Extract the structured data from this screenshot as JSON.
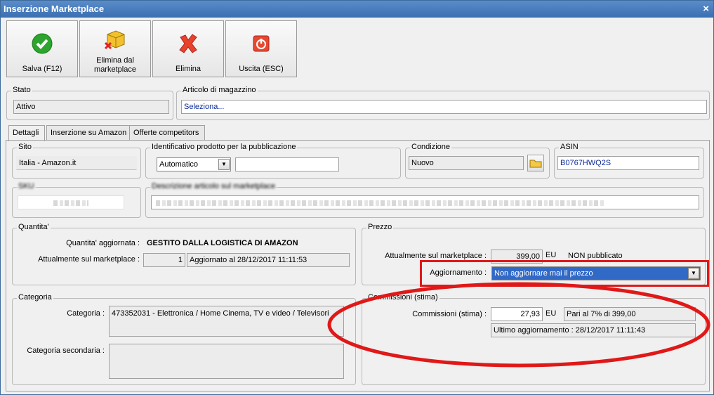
{
  "window": {
    "title": "Inserzione Marketplace",
    "close_glyph": "×"
  },
  "toolbar": {
    "save_label": "Salva (F12)",
    "remove_label_1": "Elimina dal",
    "remove_label_2": "marketplace",
    "delete_label": "Elimina",
    "exit_label": "Uscita (ESC)"
  },
  "stato": {
    "label": "Stato",
    "value": "Attivo"
  },
  "articolo": {
    "label": "Articolo di magazzino",
    "value": "Seleziona..."
  },
  "tabs": [
    "Dettagli",
    "Inserzione su Amazon",
    "Offerte competitors"
  ],
  "sito": {
    "label": "Sito",
    "value": "Italia - Amazon.it"
  },
  "identificativo": {
    "label": "Identificativo prodotto per la pubblicazione",
    "select": "Automatico",
    "value": ""
  },
  "condizione": {
    "label": "Condizione",
    "value": "Nuovo"
  },
  "asin": {
    "label": "ASIN",
    "value": "B0767HWQ2S"
  },
  "sku": {
    "label": "SKU"
  },
  "descrizione": {
    "label": "Descrizione articolo sul marketplace"
  },
  "quantita": {
    "label": "Quantita'",
    "aggiornata_label": "Quantita' aggiornata :",
    "aggiornata_value": "GESTITO DALLA LOGISTICA DI AMAZON",
    "attuale_label": "Attualmente sul marketplace :",
    "attuale_value": "1",
    "aggiornato_value": "Aggiornato al 28/12/2017 11:11:53"
  },
  "prezzo": {
    "label": "Prezzo",
    "attuale_label": "Attualmente sul marketplace :",
    "attuale_value": "399,00",
    "unit": "EU",
    "stato": "NON pubblicato",
    "aggiornamento_label": "Aggiornamento :",
    "aggiornamento_value": "Non aggiornare mai il prezzo"
  },
  "categoria": {
    "label": "Categoria",
    "cat_label": "Categoria :",
    "cat_value": "473352031 - Elettronica / Home Cinema, TV e video / Televisori",
    "sec_label": "Categoria secondaria :"
  },
  "commissioni": {
    "label": "Commissioni (stima)",
    "field_label": "Commissioni (stima) :",
    "value": "27,93",
    "unit": "EU",
    "info": "Pari al 7% di 399,00",
    "ultimo": "Ultimo aggiornamento : 28/12/2017 11:11:43"
  },
  "colors": {
    "annotation": "#e01818",
    "highlight": "#3169c6"
  }
}
